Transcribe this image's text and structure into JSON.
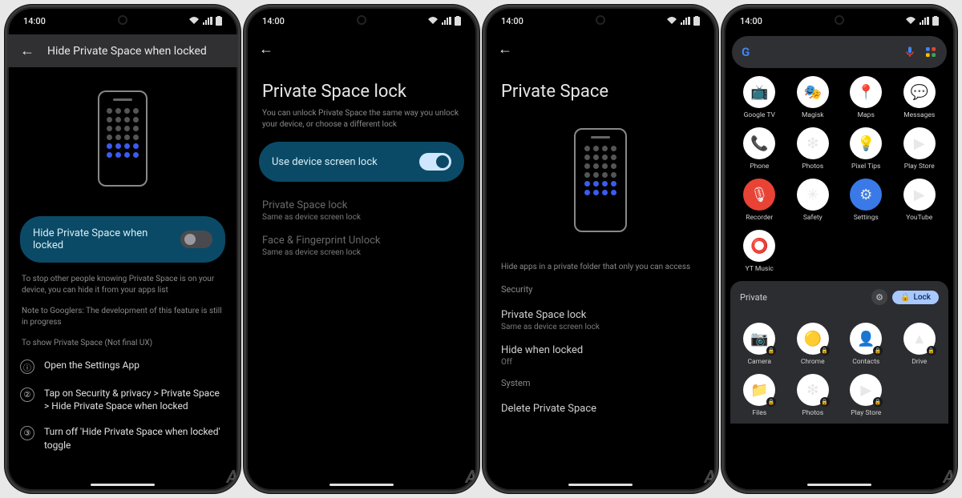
{
  "status": {
    "time": "14:00"
  },
  "screen1": {
    "header_title": "Hide Private Space when locked",
    "toggle_label": "Hide Private Space when locked",
    "note1": "To stop other people knowing Private Space is on your device, you can hide it from your apps list",
    "note2": "Note to Googlers: The development of this feature is still in progress",
    "section_label": "To show Private Space (Not final UX)",
    "steps": [
      "Open the Settings App",
      "Tap on Security & privacy > Private Space > Hide Private Space when locked",
      "Turn off 'Hide Private Space when locked' toggle"
    ]
  },
  "screen2": {
    "title": "Private Space lock",
    "sub": "You can unlock Private Space the same way you unlock your device, or choose a different lock",
    "toggle_label": "Use device screen lock",
    "rows": [
      {
        "t": "Private Space lock",
        "s": "Same as device screen lock"
      },
      {
        "t": "Face & Fingerprint Unlock",
        "s": "Same as device screen lock"
      }
    ]
  },
  "screen3": {
    "title": "Private Space",
    "hero_sub": "Hide apps in a private folder that only you can access",
    "section_security": "Security",
    "rows_sec": [
      {
        "t": "Private Space lock",
        "s": "Same as device screen lock"
      },
      {
        "t": "Hide when locked",
        "s": "Off"
      }
    ],
    "section_system": "System",
    "row_delete": "Delete Private Space"
  },
  "screen4": {
    "apps_top": [
      "Google TV",
      "Magisk",
      "Maps",
      "Messages",
      "Phone",
      "Photos",
      "Pixel Tips",
      "Play Store",
      "Recorder",
      "Safety",
      "Settings",
      "YouTube",
      "YT Music"
    ],
    "private_label": "Private",
    "lock_label": "Lock",
    "apps_private": [
      "Camera",
      "Chrome",
      "Contacts",
      "Drive",
      "Files",
      "Photos",
      "Play Store"
    ]
  },
  "icon_colors": {
    "Google TV": "#ffffff",
    "Magisk": "#ffffff",
    "Maps": "#ffffff",
    "Messages": "#ffffff",
    "Phone": "#ffffff",
    "Photos": "#ffffff",
    "Pixel Tips": "#ffffff",
    "Play Store": "#ffffff",
    "Recorder": "#e94335",
    "Safety": "#ffffff",
    "Settings": "#3a79e8",
    "YouTube": "#ffffff",
    "YT Music": "#ffffff",
    "Camera": "#ffffff",
    "Chrome": "#ffffff",
    "Contacts": "#ffffff",
    "Drive": "#ffffff",
    "Files": "#ffffff"
  },
  "icon_glyphs": {
    "Google TV": "📺",
    "Magisk": "🎭",
    "Maps": "📍",
    "Messages": "💬",
    "Phone": "📞",
    "Photos": "❇",
    "Pixel Tips": "💡",
    "Play Store": "▶",
    "Recorder": "🎙",
    "Safety": "✳",
    "Settings": "⚙",
    "YouTube": "▶",
    "YT Music": "⭕",
    "Camera": "📷",
    "Chrome": "🟡",
    "Contacts": "👤",
    "Drive": "▲",
    "Files": "📁"
  }
}
